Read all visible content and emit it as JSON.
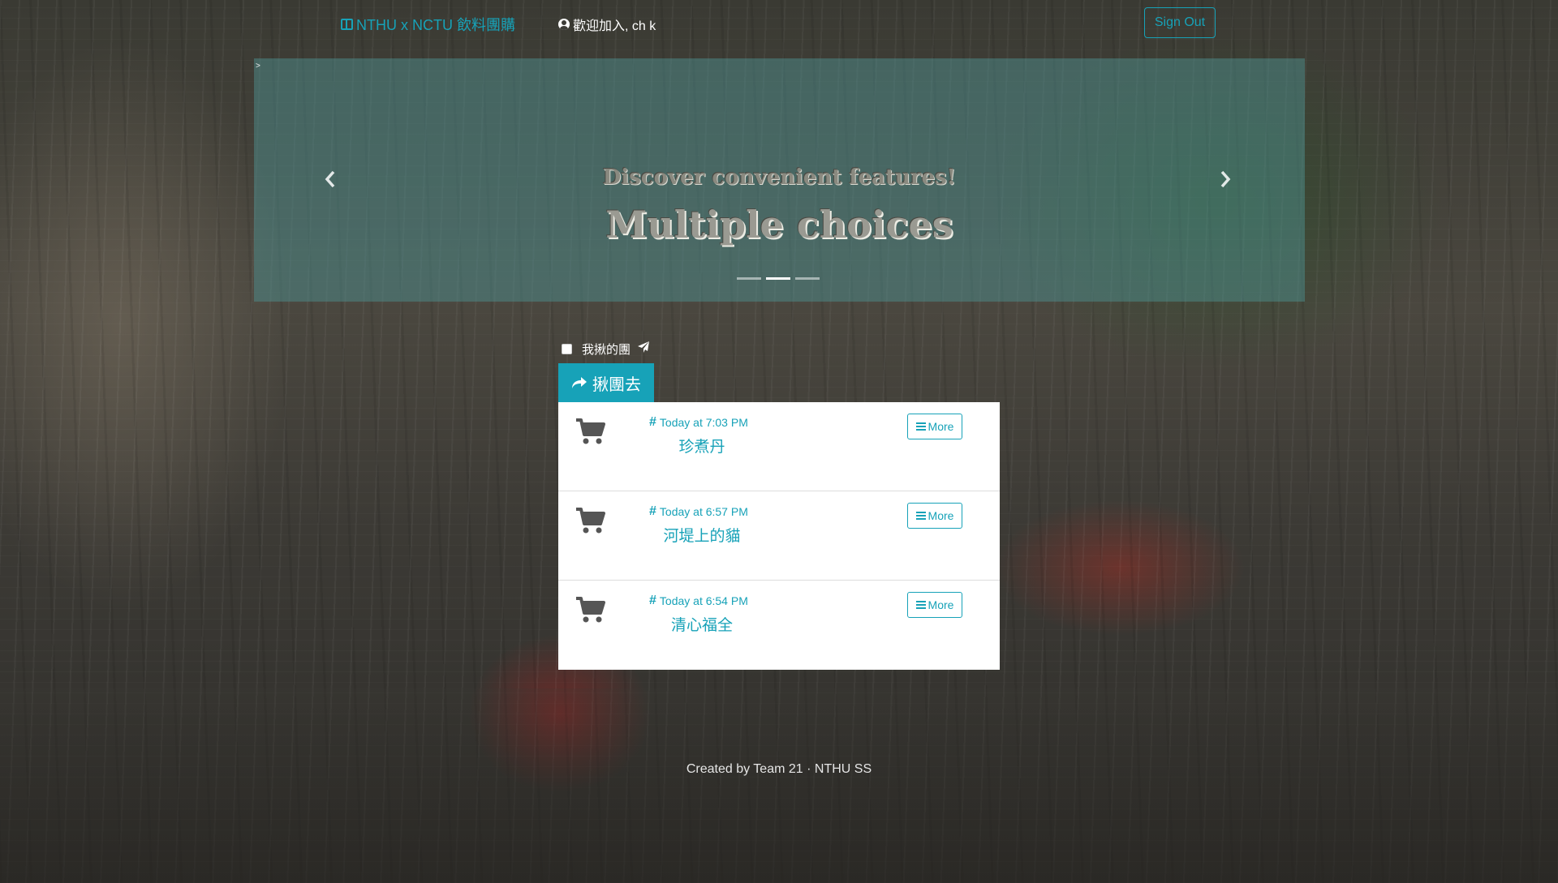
{
  "navbar": {
    "brand": "NTHU x NCTU 飲料團購",
    "welcome": "歡迎加入, ch k",
    "signout_label": "Sign Out"
  },
  "carousel": {
    "corner_mark": ">",
    "subtitle": "Discover convenient features!",
    "title": "Multiple choices",
    "prev_glyph": "‹",
    "next_glyph": "›",
    "slide_count": 3,
    "active_slide": 2
  },
  "my_group": {
    "label": "我揪的團",
    "checked": false
  },
  "go_button": {
    "label": "揪團去"
  },
  "orders": [
    {
      "time": "Today at 7:03 PM",
      "name": "珍煮丹",
      "more_label": "More"
    },
    {
      "time": "Today at 6:57 PM",
      "name": "河堤上的貓",
      "more_label": "More"
    },
    {
      "time": "Today at 6:54 PM",
      "name": "清心福全",
      "more_label": "More"
    }
  ],
  "footer": {
    "text": "Created by Team 21 · NTHU SS"
  },
  "colors": {
    "accent": "#17a2b8",
    "carousel_overlay": "rgba(80,150,150,0.45)"
  },
  "icons": [
    "book-icon",
    "user-circle-icon",
    "chevron-left-icon",
    "chevron-right-icon",
    "paper-plane-icon",
    "share-icon",
    "shopping-cart-icon",
    "hashtag-icon",
    "bars-icon"
  ]
}
